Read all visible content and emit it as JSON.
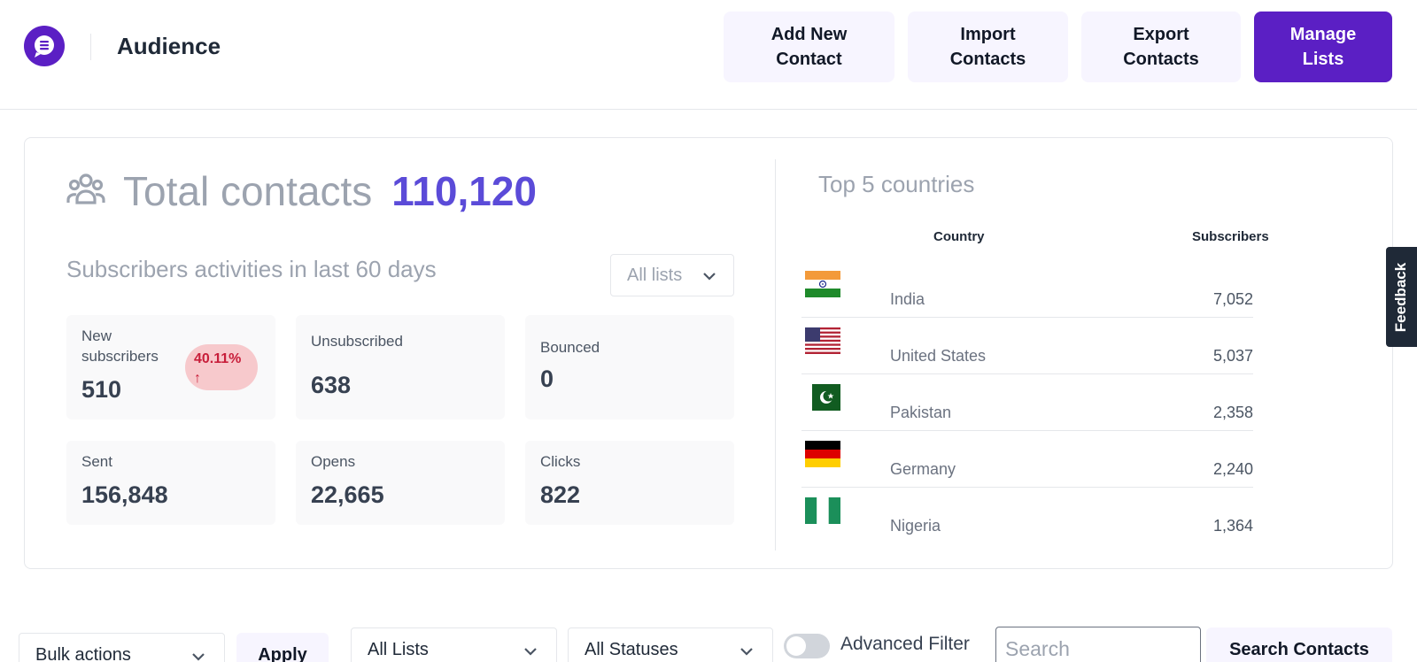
{
  "header": {
    "title": "Audience",
    "buttons": {
      "add_contact": "Add New Contact",
      "import_contacts": "Import Contacts",
      "export_contacts": "Export Contacts",
      "manage_lists": "Manage Lists"
    }
  },
  "stats": {
    "total_label": "Total contacts",
    "total_value": "110,120",
    "activity_title": "Subscribers activities in last 60 days",
    "list_filter": "All lists",
    "cards": {
      "new_subscribers": {
        "label": "New subscribers",
        "value": "510",
        "badge": "40.11%",
        "badge_arrow": "↑"
      },
      "unsubscribed": {
        "label": "Unsubscribed",
        "value": "638"
      },
      "bounced": {
        "label": "Bounced",
        "value": "0"
      },
      "sent": {
        "label": "Sent",
        "value": "156,848"
      },
      "opens": {
        "label": "Opens",
        "value": "22,665"
      },
      "clicks": {
        "label": "Clicks",
        "value": "822"
      }
    }
  },
  "countries": {
    "title": "Top 5 countries",
    "col_country": "Country",
    "col_subscribers": "Subscribers",
    "rows": [
      {
        "name": "India",
        "count": "7,052",
        "flag": "india-flag-icon"
      },
      {
        "name": "United States",
        "count": "5,037",
        "flag": "us-flag-icon"
      },
      {
        "name": "Pakistan",
        "count": "2,358",
        "flag": "pakistan-flag-icon"
      },
      {
        "name": "Germany",
        "count": "2,240",
        "flag": "germany-flag-icon"
      },
      {
        "name": "Nigeria",
        "count": "1,364",
        "flag": "nigeria-flag-icon"
      }
    ]
  },
  "feedback": "Feedback",
  "filters": {
    "bulk_actions": "Bulk actions",
    "apply": "Apply",
    "all_lists": "All Lists",
    "all_statuses": "All Statuses",
    "advanced_filter": "Advanced Filter",
    "search_placeholder": "Search",
    "search_button": "Search Contacts"
  },
  "colors": {
    "brand": "#5b1fc4",
    "total_accent": "#5b4bd8",
    "badge_bg": "#f7c9cc",
    "badge_text": "#c81e3a"
  }
}
